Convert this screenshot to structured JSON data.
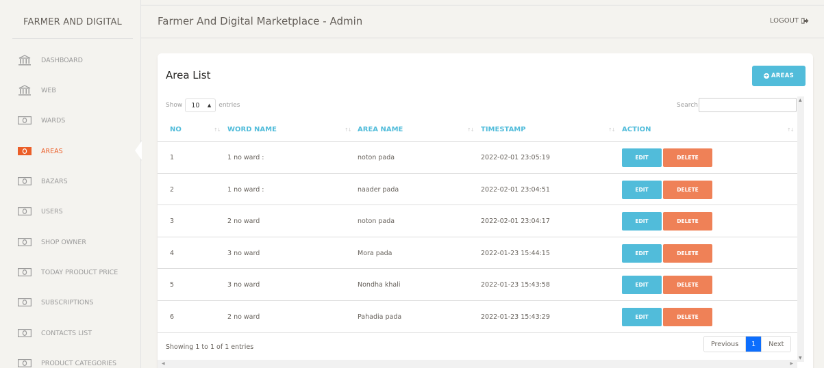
{
  "app": {
    "brand": "FARMER AND DIGITAL",
    "page_title": "Farmer And Digital Marketplace - Admin",
    "logout": "LOGOUT"
  },
  "sidebar": {
    "items": [
      {
        "label": "DASHBOARD",
        "icon": "bank-icon",
        "active": false
      },
      {
        "label": "WEB",
        "icon": "bank-icon",
        "active": false
      },
      {
        "label": "WARDS",
        "icon": "money-icon",
        "active": false
      },
      {
        "label": "AREAS",
        "icon": "money-icon",
        "active": true
      },
      {
        "label": "BAZARS",
        "icon": "money-icon",
        "active": false
      },
      {
        "label": "USERS",
        "icon": "money-icon",
        "active": false
      },
      {
        "label": "SHOP OWNER",
        "icon": "money-icon",
        "active": false
      },
      {
        "label": "TODAY PRODUCT PRICE",
        "icon": "money-icon",
        "active": false
      },
      {
        "label": "SUBSCRIPTIONS",
        "icon": "money-icon",
        "active": false
      },
      {
        "label": "CONTACTS LIST",
        "icon": "money-icon",
        "active": false
      },
      {
        "label": "PRODUCT CATEGORIES",
        "icon": "money-icon",
        "active": false
      }
    ]
  },
  "card": {
    "title": "Area List",
    "add_button": "AREAS",
    "length": {
      "show": "Show",
      "value": "10",
      "entries": "entries"
    },
    "search_label": "Search:",
    "search_value": "",
    "columns": [
      "NO",
      "WORD NAME",
      "AREA NAME",
      "TIMESTAMP",
      "ACTION"
    ],
    "rows": [
      {
        "no": "1",
        "word": "1 no ward :",
        "area": "noton pada",
        "timestamp": "2022-02-01 23:05:19"
      },
      {
        "no": "2",
        "word": "1 no ward :",
        "area": "naader pada",
        "timestamp": "2022-02-01 23:04:51"
      },
      {
        "no": "3",
        "word": "2 no ward",
        "area": "noton pada",
        "timestamp": "2022-02-01 23:04:17"
      },
      {
        "no": "4",
        "word": "3 no ward",
        "area": "Mora pada",
        "timestamp": "2022-01-23 15:44:15"
      },
      {
        "no": "5",
        "word": "3 no ward",
        "area": "Nondha khali",
        "timestamp": "2022-01-23 15:43:58"
      },
      {
        "no": "6",
        "word": "2 no ward",
        "area": "Pahadia pada",
        "timestamp": "2022-01-23 15:43:29"
      }
    ],
    "edit_label": "EDIT",
    "delete_label": "DELETE",
    "showing": "Showing 1 to 1 of 1 entries",
    "pager": {
      "previous": "Previous",
      "current": "1",
      "next": "Next"
    }
  },
  "colors": {
    "accent": "#51bcda",
    "danger": "#ef8157",
    "active": "#eb5e28",
    "page_current": "#0d6efd"
  }
}
